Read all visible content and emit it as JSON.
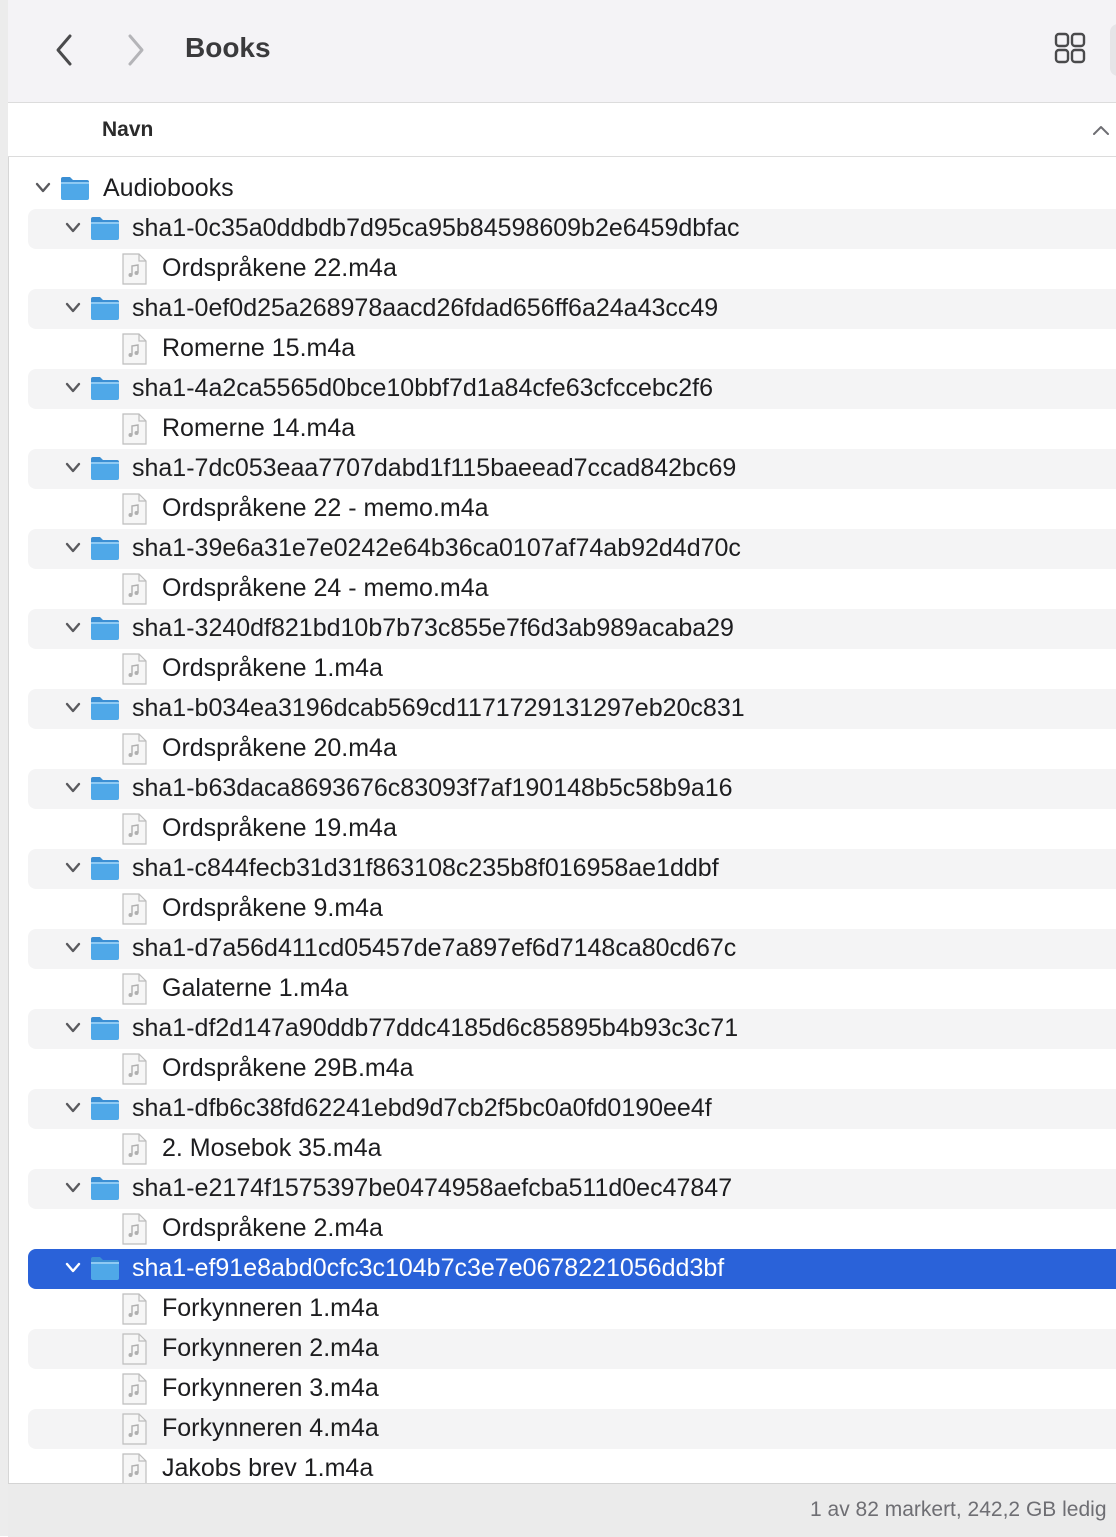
{
  "window": {
    "title": "Books"
  },
  "toolbar": {
    "back_icon": "chevron-left-icon",
    "forward_icon": "chevron-right-icon",
    "view_icon": "grid-view-icon"
  },
  "columns": {
    "name": "Navn",
    "sort": "ascending"
  },
  "colors": {
    "selection": "#2a62d9",
    "folder": "#4fa8e8",
    "alt_row": "#f4f4f5"
  },
  "rows": [
    {
      "name": "Audiobooks",
      "type": "folder",
      "level": 0,
      "expanded": true
    },
    {
      "name": "sha1-0c35a0ddbdb7d95ca95b84598609b2e6459dbfac",
      "type": "folder",
      "level": 1,
      "expanded": true
    },
    {
      "name": "Ordspråkene 22.m4a",
      "type": "file",
      "level": 2
    },
    {
      "name": "sha1-0ef0d25a268978aacd26fdad656ff6a24a43cc49",
      "type": "folder",
      "level": 1,
      "expanded": true
    },
    {
      "name": "Romerne 15.m4a",
      "type": "file",
      "level": 2
    },
    {
      "name": "sha1-4a2ca5565d0bce10bbf7d1a84cfe63cfccebc2f6",
      "type": "folder",
      "level": 1,
      "expanded": true
    },
    {
      "name": "Romerne 14.m4a",
      "type": "file",
      "level": 2
    },
    {
      "name": "sha1-7dc053eaa7707dabd1f115baeead7ccad842bc69",
      "type": "folder",
      "level": 1,
      "expanded": true
    },
    {
      "name": "Ordspråkene 22 - memo.m4a",
      "type": "file",
      "level": 2
    },
    {
      "name": "sha1-39e6a31e7e0242e64b36ca0107af74ab92d4d70c",
      "type": "folder",
      "level": 1,
      "expanded": true
    },
    {
      "name": "Ordspråkene 24 - memo.m4a",
      "type": "file",
      "level": 2
    },
    {
      "name": "sha1-3240df821bd10b7b73c855e7f6d3ab989acaba29",
      "type": "folder",
      "level": 1,
      "expanded": true
    },
    {
      "name": "Ordspråkene 1.m4a",
      "type": "file",
      "level": 2
    },
    {
      "name": "sha1-b034ea3196dcab569cd1171729131297eb20c831",
      "type": "folder",
      "level": 1,
      "expanded": true
    },
    {
      "name": "Ordspråkene 20.m4a",
      "type": "file",
      "level": 2
    },
    {
      "name": "sha1-b63daca8693676c83093f7af190148b5c58b9a16",
      "type": "folder",
      "level": 1,
      "expanded": true
    },
    {
      "name": "Ordspråkene 19.m4a",
      "type": "file",
      "level": 2
    },
    {
      "name": "sha1-c844fecb31d31f863108c235b8f016958ae1ddbf",
      "type": "folder",
      "level": 1,
      "expanded": true
    },
    {
      "name": "Ordspråkene 9.m4a",
      "type": "file",
      "level": 2
    },
    {
      "name": "sha1-d7a56d411cd05457de7a897ef6d7148ca80cd67c",
      "type": "folder",
      "level": 1,
      "expanded": true
    },
    {
      "name": "Galaterne 1.m4a",
      "type": "file",
      "level": 2
    },
    {
      "name": "sha1-df2d147a90ddb77ddc4185d6c85895b4b93c3c71",
      "type": "folder",
      "level": 1,
      "expanded": true
    },
    {
      "name": "Ordspråkene 29B.m4a",
      "type": "file",
      "level": 2
    },
    {
      "name": "sha1-dfb6c38fd62241ebd9d7cb2f5bc0a0fd0190ee4f",
      "type": "folder",
      "level": 1,
      "expanded": true
    },
    {
      "name": "2. Mosebok 35.m4a",
      "type": "file",
      "level": 2
    },
    {
      "name": "sha1-e2174f1575397be0474958aefcba511d0ec47847",
      "type": "folder",
      "level": 1,
      "expanded": true
    },
    {
      "name": "Ordspråkene 2.m4a",
      "type": "file",
      "level": 2
    },
    {
      "name": "sha1-ef91e8abd0cfc3c104b7c3e7e0678221056dd3bf",
      "type": "folder",
      "level": 1,
      "expanded": true,
      "selected": true
    },
    {
      "name": "Forkynneren 1.m4a",
      "type": "file",
      "level": 2
    },
    {
      "name": "Forkynneren 2.m4a",
      "type": "file",
      "level": 2
    },
    {
      "name": "Forkynneren 3.m4a",
      "type": "file",
      "level": 2
    },
    {
      "name": "Forkynneren 4.m4a",
      "type": "file",
      "level": 2
    },
    {
      "name": "Jakobs brev 1.m4a",
      "type": "file",
      "level": 2
    }
  ],
  "status": {
    "text": "1 av 82 markert, 242,2 GB ledig"
  }
}
